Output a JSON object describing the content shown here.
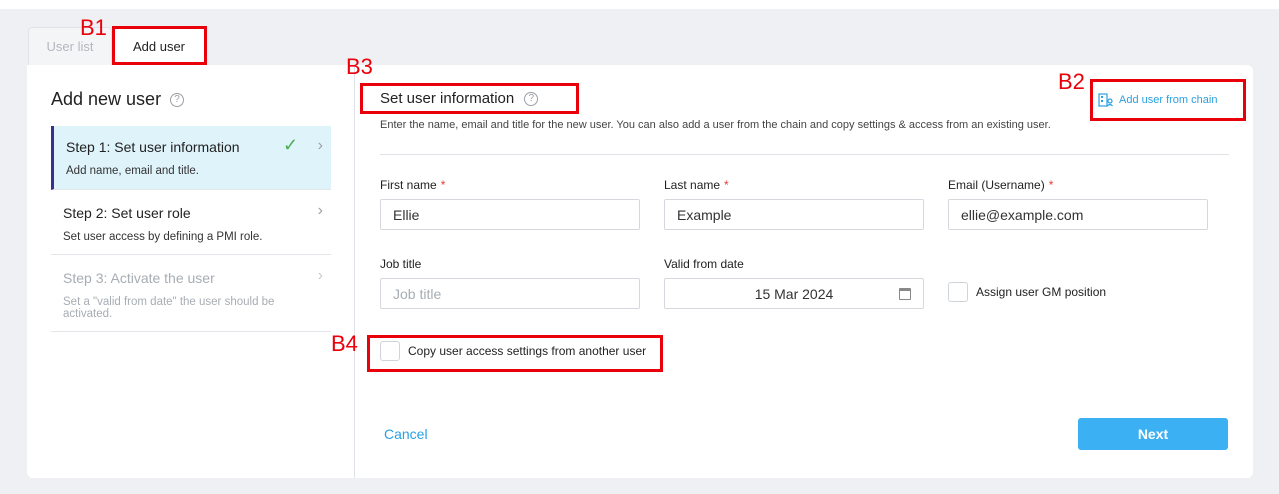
{
  "tabs": {
    "user_list": "User list",
    "add_user": "Add user"
  },
  "sidebar": {
    "title": "Add new user",
    "steps": [
      {
        "title": "Step 1: Set user information",
        "desc": "Add name, email and title."
      },
      {
        "title": "Step 2: Set user role",
        "desc": "Set user access by defining a PMI role."
      },
      {
        "title": "Step 3: Activate the user",
        "desc": "Set a \"valid from date\" the user should be activated."
      }
    ]
  },
  "section": {
    "title": "Set user information",
    "desc": "Enter the name, email and title for the new user. You can also add a user from the chain and copy settings & access from an existing user.",
    "chain_link": "Add user from chain"
  },
  "form": {
    "first_name_label": "First name",
    "first_name_value": "Ellie",
    "last_name_label": "Last name",
    "last_name_value": "Example",
    "email_label": "Email (Username)",
    "email_value": "ellie@example.com",
    "required_mark": "*",
    "job_title_label": "Job title",
    "job_title_placeholder": "Job title",
    "valid_from_label": "Valid from date",
    "valid_from_value": "15 Mar 2024",
    "gm_position_label": "Assign user GM position",
    "copy_access_label": "Copy user access settings from another user"
  },
  "actions": {
    "cancel": "Cancel",
    "next": "Next"
  },
  "annotations": {
    "b1": "B1",
    "b2": "B2",
    "b3": "B3",
    "b4": "B4"
  },
  "colors": {
    "accent": "#3bb0f3",
    "link": "#2aa0e0",
    "annotation": "#e8000b",
    "active_step_bg": "#dff3fb",
    "check": "#4caf50"
  }
}
